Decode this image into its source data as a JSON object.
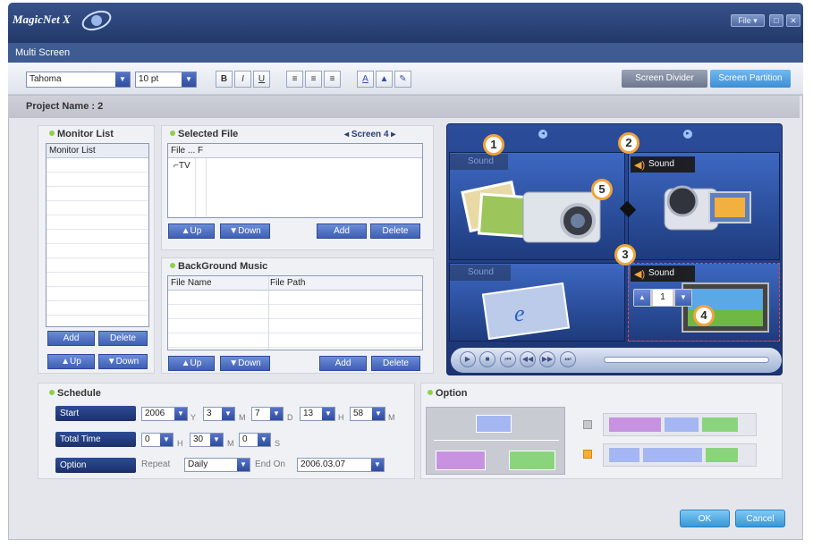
{
  "window": {
    "title": "MagicNet X",
    "file_menu": "File ▾",
    "minimize": "□",
    "close": "✕"
  },
  "menu": {
    "label": "Multi Screen"
  },
  "toolbar": {
    "font": "Tahoma",
    "size": "10 pt",
    "bold": "B",
    "italic": "I",
    "underline": "U",
    "tab_divider": "Screen Divider",
    "tab_partition": "Screen Partition"
  },
  "project": {
    "name": "Project Name : 2"
  },
  "monitor": {
    "title": "Monitor List",
    "header": "Monitor List",
    "add": "Add",
    "delete": "Delete",
    "up": "Up",
    "down": "Down"
  },
  "selected": {
    "title": "Selected File",
    "screen": "Screen 4",
    "header": "File ... F",
    "item": "TV",
    "up": "Up",
    "down": "Down",
    "add": "Add",
    "delete": "Delete"
  },
  "music": {
    "title": "BackGround Music",
    "col1": "File Name",
    "col2": "File Path",
    "up": "Up",
    "down": "Down",
    "add": "Add",
    "delete": "Delete"
  },
  "preview": {
    "sound": "Sound",
    "badges": [
      "1",
      "2",
      "3",
      "4",
      "5"
    ],
    "spin_value": "1"
  },
  "schedule": {
    "title": "Schedule",
    "start_label": "Start",
    "start": {
      "year": "2006",
      "y": "Y",
      "month": "3",
      "m": "M",
      "day": "7",
      "d": "D",
      "hour": "13",
      "h": "H",
      "minute": "58",
      "mi": "M"
    },
    "total_label": "Total Time",
    "total": {
      "h": "0",
      "hl": "H",
      "m": "30",
      "ml": "M",
      "s": "0",
      "sl": "S"
    },
    "option_label": "Option",
    "repeat_label": "Repeat",
    "repeat": "Daily",
    "endon_label": "End On",
    "endon": "2006.03.07"
  },
  "option": {
    "title": "Option"
  },
  "footer": {
    "ok": "OK",
    "cancel": "Cancel"
  },
  "colors": {
    "accent": "#3e5fb4",
    "title": "#2b4378",
    "badge": "#f3a33a"
  }
}
